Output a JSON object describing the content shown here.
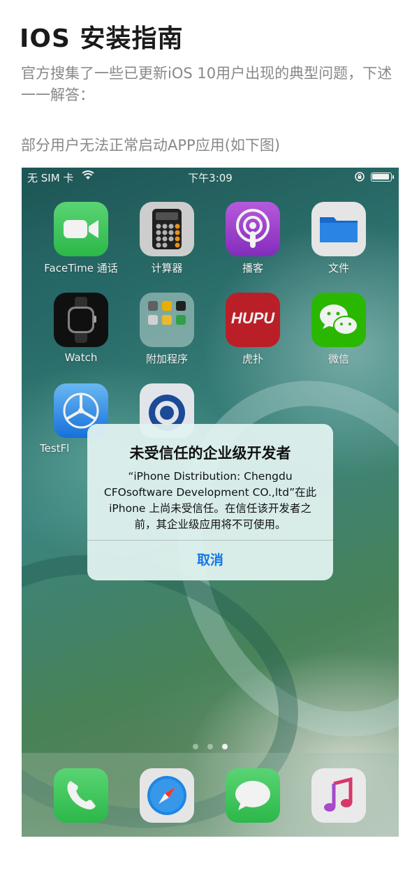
{
  "article": {
    "title": "IOS 安装指南",
    "intro": "官方搜集了一些已更新iOS 10用户出现的典型问题，下述一一解答：",
    "section_label": "部分用户无法正常启动APP应用(如下图)"
  },
  "phone": {
    "status_bar": {
      "carrier": "无 SIM 卡",
      "time": "下午3:09"
    },
    "apps": [
      {
        "label": "FaceTime 通话",
        "icon": "facetime-icon"
      },
      {
        "label": "计算器",
        "icon": "calculator-icon"
      },
      {
        "label": "播客",
        "icon": "podcasts-icon"
      },
      {
        "label": "文件",
        "icon": "files-icon"
      },
      {
        "label": "Watch",
        "icon": "watch-icon"
      },
      {
        "label": "附加程序",
        "icon": "folder-icon"
      },
      {
        "label": "虎扑",
        "icon": "hupu-icon",
        "icon_text": "HUPU"
      },
      {
        "label": "微信",
        "icon": "wechat-icon"
      },
      {
        "label": "TestFl",
        "icon": "testflight-icon"
      }
    ],
    "dock": [
      {
        "icon": "phone-icon"
      },
      {
        "icon": "safari-icon"
      },
      {
        "icon": "messages-icon"
      },
      {
        "icon": "music-icon"
      }
    ],
    "alert": {
      "title": "未受信任的企业级开发者",
      "message": "“iPhone Distribution: Chengdu CFOsoftware Development CO.,ltd”在此 iPhone 上尚未受信任。在信任该开发者之前，其企业级应用将不可使用。",
      "cancel_label": "取消"
    }
  },
  "colors": {
    "alert_button": "#1277e6",
    "facetime": "#3bd35b",
    "podcasts": "#9b3fd6",
    "hupu": "#c4212b",
    "wechat": "#2dc100"
  }
}
